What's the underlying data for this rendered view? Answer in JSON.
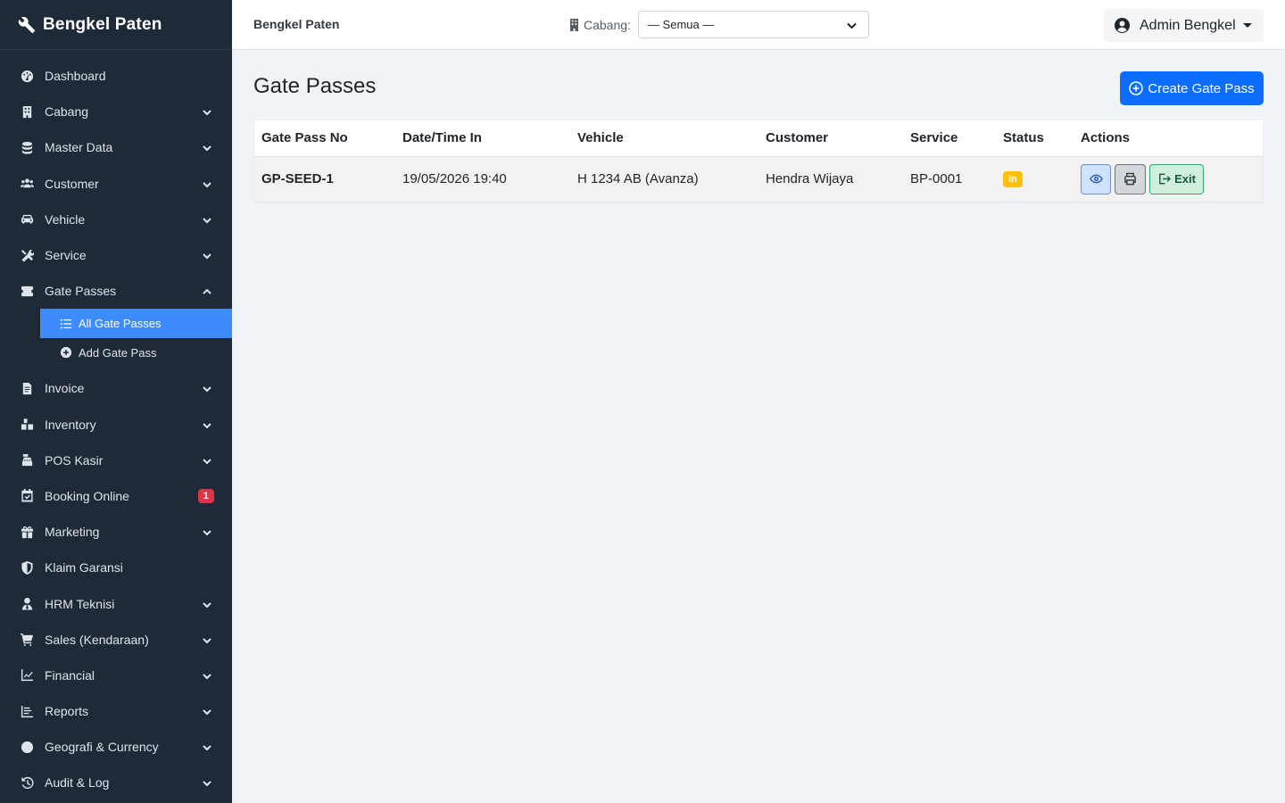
{
  "brand": {
    "name": "Bengkel Paten"
  },
  "sidebar": {
    "items": [
      {
        "label": "Dashboard",
        "icon": "dashboard-icon",
        "expandable": false
      },
      {
        "label": "Cabang",
        "icon": "building-icon",
        "expandable": true
      },
      {
        "label": "Master Data",
        "icon": "database-icon",
        "expandable": true
      },
      {
        "label": "Customer",
        "icon": "users-icon",
        "expandable": true
      },
      {
        "label": "Vehicle",
        "icon": "car-icon",
        "expandable": true
      },
      {
        "label": "Service",
        "icon": "tools-icon",
        "expandable": true
      },
      {
        "label": "Gate Passes",
        "icon": "ticket-icon",
        "expandable": true,
        "expanded": true
      },
      {
        "label": "Invoice",
        "icon": "invoice-icon",
        "expandable": true
      },
      {
        "label": "Inventory",
        "icon": "boxes-icon",
        "expandable": true
      },
      {
        "label": "POS Kasir",
        "icon": "cash-register-icon",
        "expandable": true
      },
      {
        "label": "Booking Online",
        "icon": "calendar-check-icon",
        "expandable": false,
        "badge": "1"
      },
      {
        "label": "Marketing",
        "icon": "gift-icon",
        "expandable": true
      },
      {
        "label": "Klaim Garansi",
        "icon": "shield-icon",
        "expandable": false
      },
      {
        "label": "HRM Teknisi",
        "icon": "user-tie-icon",
        "expandable": true
      },
      {
        "label": "Sales (Kendaraan)",
        "icon": "cart-icon",
        "expandable": true
      },
      {
        "label": "Financial",
        "icon": "chart-line-icon",
        "expandable": true
      },
      {
        "label": "Reports",
        "icon": "report-icon",
        "expandable": true
      },
      {
        "label": "Geografi & Currency",
        "icon": "globe-icon",
        "expandable": true
      },
      {
        "label": "Audit & Log",
        "icon": "history-icon",
        "expandable": true
      }
    ],
    "gate_pass_sub": [
      {
        "label": "All Gate Passes",
        "icon": "list-icon",
        "active": true
      },
      {
        "label": "Add Gate Pass",
        "icon": "plus-circle-icon",
        "active": false
      }
    ]
  },
  "topbar": {
    "title": "Bengkel Paten",
    "branch_label": "Cabang:",
    "branch_value": "— Semua —",
    "user_name": "Admin Bengkel"
  },
  "page": {
    "title": "Gate Passes",
    "create_button": "Create Gate Pass"
  },
  "table": {
    "headers": [
      "Gate Pass No",
      "Date/Time In",
      "Vehicle",
      "Customer",
      "Service",
      "Status",
      "Actions"
    ],
    "rows": [
      {
        "gate_pass_no": "GP-SEED-1",
        "datetime_in": "19/05/2026 19:40",
        "vehicle": "H 1234 AB (Avanza)",
        "customer": "Hendra Wijaya",
        "service": "BP-0001",
        "status": "In",
        "exit_label": "Exit"
      }
    ]
  },
  "colors": {
    "sidebar_bg": "#1f2a38",
    "active_item": "#3d8bfd",
    "primary": "#0d6efd",
    "status_in": "#ffc107",
    "badge_red": "#dc3545"
  }
}
